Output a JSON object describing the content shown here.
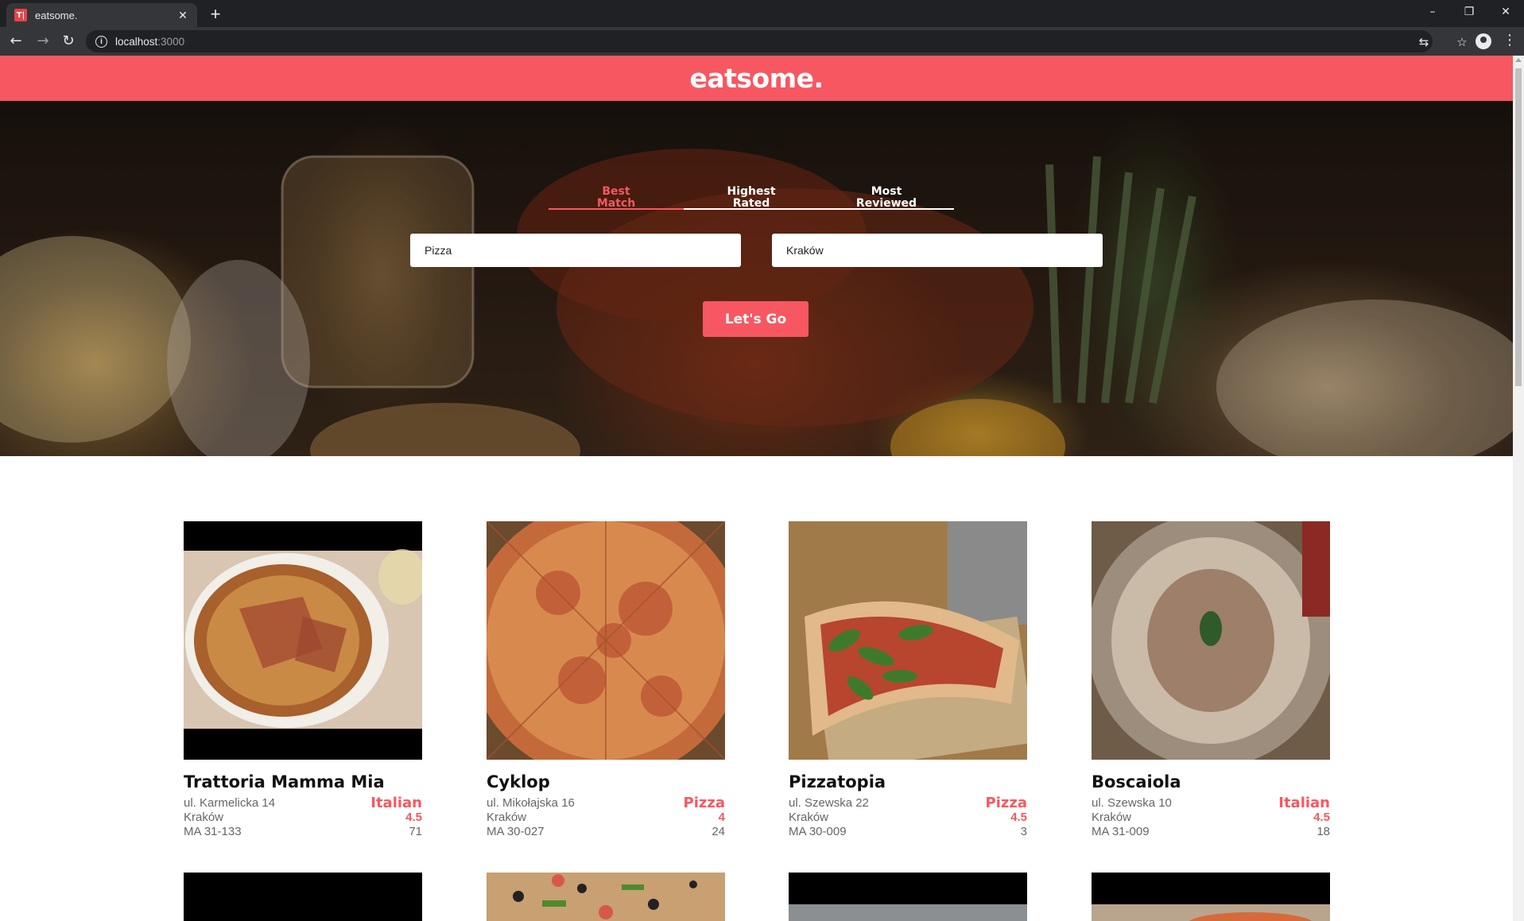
{
  "browser": {
    "tab_title": "eatsome.",
    "favicon_text": "T|",
    "url_host": "localhost",
    "url_port": ":3000"
  },
  "header": {
    "brand": "eatsome."
  },
  "sort_options": [
    {
      "line1": "Best",
      "line2": "Match",
      "active": true
    },
    {
      "line1": "Highest",
      "line2": "Rated",
      "active": false
    },
    {
      "line1": "Most",
      "line2": "Reviewed",
      "active": false
    }
  ],
  "search": {
    "term": "Pizza",
    "location": "Kraków",
    "button_label": "Let's Go"
  },
  "businesses": [
    {
      "name": "Trattoria Mamma Mia",
      "address": "ul. Karmelicka 14",
      "city": "Kraków",
      "state_zip": "MA 31-133",
      "category": "Italian",
      "rating": "4.5",
      "reviews": "71"
    },
    {
      "name": "Cyklop",
      "address": "ul. Mikołajska 16",
      "city": "Kraków",
      "state_zip": "MA 30-027",
      "category": "Pizza",
      "rating": "4",
      "reviews": "24"
    },
    {
      "name": "Pizzatopia",
      "address": "ul. Szewska 22",
      "city": "Kraków",
      "state_zip": "MA 30-009",
      "category": "Pizza",
      "rating": "4.5",
      "reviews": "3"
    },
    {
      "name": "Boscaiola",
      "address": "ul. Szewska 10",
      "city": "Kraków",
      "state_zip": "MA 31-009",
      "category": "Italian",
      "rating": "4.5",
      "reviews": "18"
    }
  ],
  "colors": {
    "brand": "#f75761",
    "chrome_dark": "#202124",
    "chrome_mid": "#35363a"
  }
}
